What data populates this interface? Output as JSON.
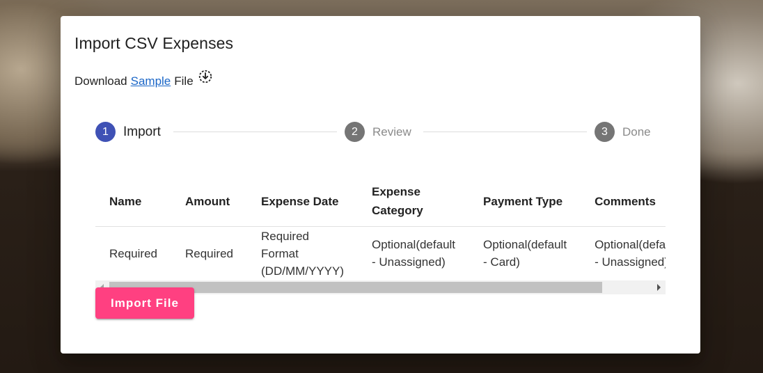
{
  "dialog": {
    "title": "Import CSV Expenses",
    "download": {
      "prefix": "Download",
      "link": "Sample",
      "suffix": "File",
      "icon": "download-circle-icon"
    }
  },
  "stepper": {
    "steps": [
      {
        "number": "1",
        "label": "Import",
        "state": "active"
      },
      {
        "number": "2",
        "label": "Review",
        "state": "inactive"
      },
      {
        "number": "3",
        "label": "Done",
        "state": "inactive"
      }
    ]
  },
  "table": {
    "headers": [
      "Name",
      "Amount",
      "Expense Date",
      "Expense Category",
      "Payment Type",
      "Comments"
    ],
    "row": [
      "Required",
      "Required",
      "Required Format (DD/MM/YYYY)",
      "Optional(default - Unassigned)",
      "Optional(default - Card)",
      "Optional(default - Unassigned)"
    ]
  },
  "actions": {
    "import_label": "Import File"
  },
  "colors": {
    "primary": "#3f51b5",
    "accent": "#ff4081",
    "link": "#1a66c7"
  }
}
